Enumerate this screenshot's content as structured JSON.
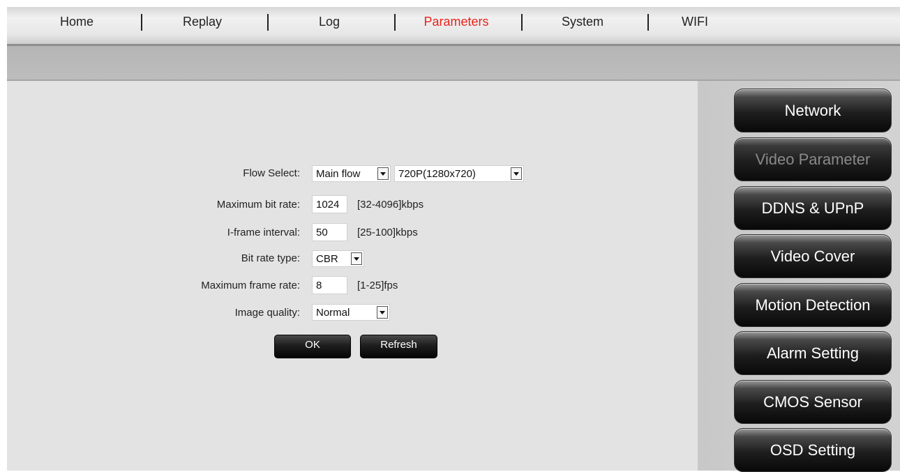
{
  "nav": {
    "items": [
      {
        "label": "Home"
      },
      {
        "label": "Replay"
      },
      {
        "label": "Log"
      },
      {
        "label": "Parameters"
      },
      {
        "label": "System"
      },
      {
        "label": "WIFI"
      }
    ],
    "active": "Parameters"
  },
  "sidebar": {
    "items": [
      {
        "label": "Network"
      },
      {
        "label": "Video Parameter"
      },
      {
        "label": "DDNS & UPnP"
      },
      {
        "label": "Video Cover"
      },
      {
        "label": "Motion Detection"
      },
      {
        "label": "Alarm Setting"
      },
      {
        "label": "CMOS Sensor"
      },
      {
        "label": "OSD Setting"
      }
    ],
    "active": "Video Parameter"
  },
  "form": {
    "flow_select": {
      "label": "Flow Select:",
      "flow_value": "Main flow",
      "resolution_value": "720P(1280x720)"
    },
    "max_bit_rate": {
      "label": "Maximum bit rate:",
      "value": "1024",
      "hint": "[32-4096]kbps"
    },
    "iframe_interval": {
      "label": "I-frame interval:",
      "value": "50",
      "hint": "[25-100]kbps"
    },
    "bit_rate_type": {
      "label": "Bit rate type:",
      "value": "CBR"
    },
    "max_frame_rate": {
      "label": "Maximum frame rate:",
      "value": "8",
      "hint": "[1-25]fps"
    },
    "image_quality": {
      "label": "Image quality:",
      "value": "Normal"
    },
    "ok_label": "OK",
    "refresh_label": "Refresh"
  },
  "colors": {
    "active_nav": "#e8221b",
    "button_dark": "#1e1e1e"
  }
}
